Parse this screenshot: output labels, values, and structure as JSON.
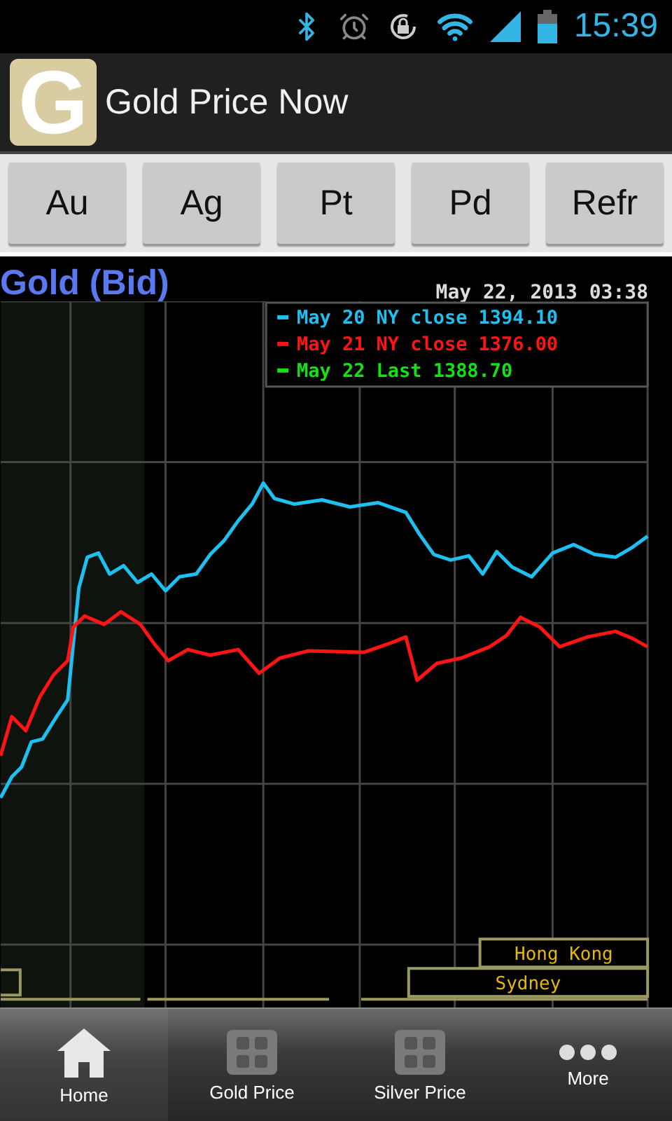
{
  "status_bar": {
    "time": "15:39"
  },
  "app_bar": {
    "logo": "G",
    "title": "Gold Price Now"
  },
  "metal_buttons": [
    {
      "label": "Au"
    },
    {
      "label": "Ag"
    },
    {
      "label": "Pt"
    },
    {
      "label": "Pd"
    },
    {
      "label": "Refr"
    }
  ],
  "chart": {
    "title": "Gold (Bid)",
    "timestamp": "May 22, 2013 03:38",
    "legend": [
      {
        "label": "May 20 NY close 1394.10",
        "color": "#1ec0f0"
      },
      {
        "label": "May 21 NY close 1376.00",
        "color": "#ff1414"
      },
      {
        "label": "May 22 Last 1388.70",
        "color": "#14e014"
      }
    ],
    "sessions": [
      "Hong Kong",
      "Sydney"
    ]
  },
  "tabs": [
    {
      "label": "Home",
      "kind": "home",
      "selected": true
    },
    {
      "label": "Gold Price",
      "kind": "grid",
      "selected": false
    },
    {
      "label": "Silver Price",
      "kind": "grid",
      "selected": false
    },
    {
      "label": "More",
      "kind": "more",
      "selected": false
    }
  ]
}
